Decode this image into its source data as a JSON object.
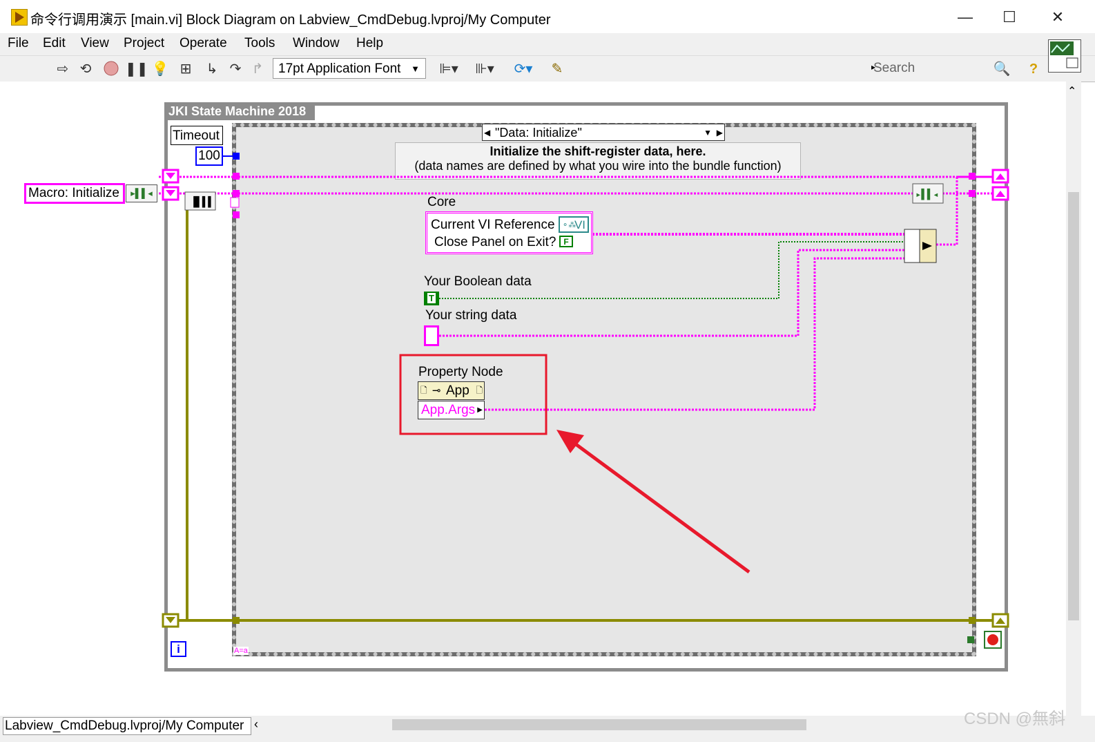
{
  "window": {
    "title": "命令行调用演示 [main.vi] Block Diagram on Labview_CmdDebug.lvproj/My Computer",
    "minimize": "—",
    "maximize": "☐",
    "close": "✕"
  },
  "menu": [
    "File",
    "Edit",
    "View",
    "Project",
    "Operate",
    "Tools",
    "Window",
    "Help"
  ],
  "toolbar": {
    "font_select": "17pt Application Font",
    "search_placeholder": "Search"
  },
  "diagram": {
    "state_machine_label": "JKI State Machine 2018",
    "timeout_label": "Timeout",
    "timeout_value": "100",
    "macro_label": "Macro: Initialize",
    "case_selector": "\"Data: Initialize\"",
    "comment_line1": "Initialize the shift-register data, here.",
    "comment_line2": "(data names are defined by what you wire into the bundle function)",
    "core_label": "Core",
    "core_field1": "Current VI Reference",
    "core_field2": "Close Panel on Exit?",
    "vi_ref": "VI",
    "bool_false": "F",
    "bool_label": "Your Boolean data",
    "bool_true": "T",
    "string_label": "Your string data",
    "property_node_label": "Property Node",
    "pn_class": "App",
    "pn_property": "App.Args",
    "iteration": "i",
    "case_tag": "A=a"
  },
  "statusbar": {
    "project_path": "Labview_CmdDebug.lvproj/My Computer"
  },
  "watermark": "CSDN @無斜",
  "colors": {
    "string_wire": "#ff00ff",
    "bool_wire": "#008000",
    "cluster_wire": "#8b8b00",
    "numeric": "#0000ff",
    "highlight_box": "#e8192c"
  }
}
